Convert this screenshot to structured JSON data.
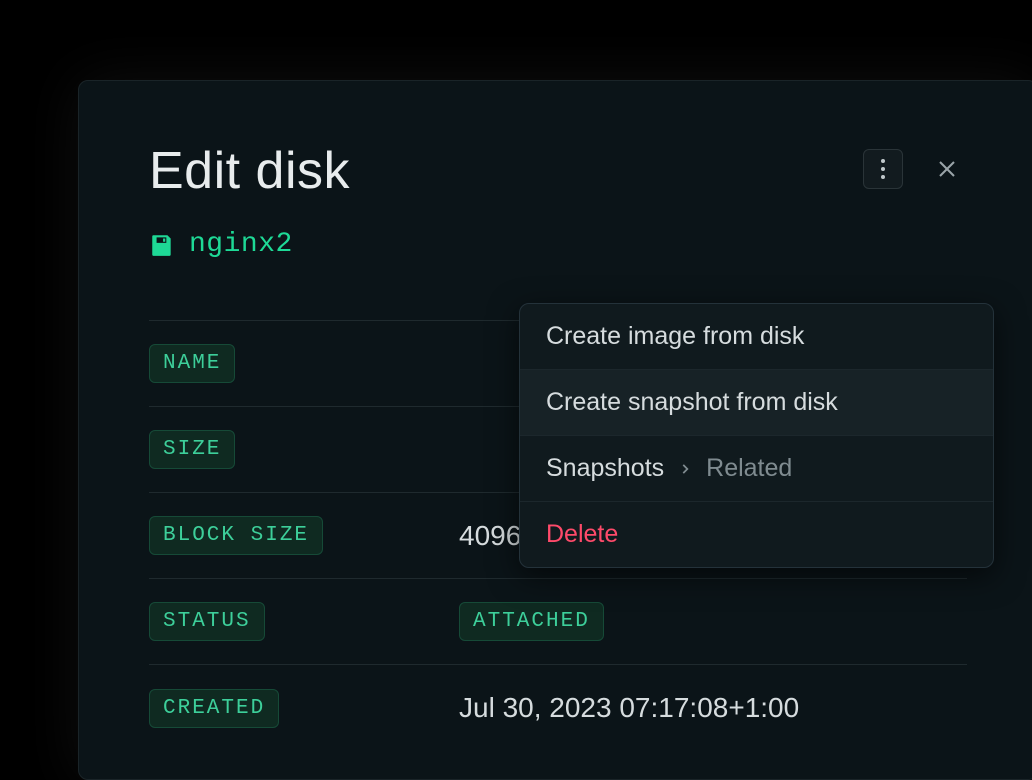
{
  "header": {
    "title": "Edit disk",
    "disk_name": "nginx2"
  },
  "menu": {
    "create_image": "Create image from disk",
    "create_snapshot": "Create snapshot from disk",
    "snapshots_label": "Snapshots",
    "snapshots_related": "Related",
    "delete": "Delete"
  },
  "rows": {
    "name_label": "NAME",
    "size_label": "SIZE",
    "block_size_label": "BLOCK SIZE",
    "block_size_value": "4096",
    "status_label": "STATUS",
    "status_value": "ATTACHED",
    "created_label": "CREATED",
    "created_value": "Jul 30, 2023 07:17:08+1:00"
  }
}
